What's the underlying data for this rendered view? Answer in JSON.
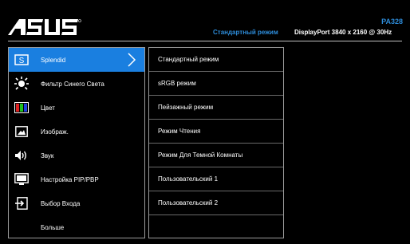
{
  "header": {
    "model": "PA328",
    "mode": "Стандартный режим",
    "signal": "DisplayPort  3840 x 2160 @ 30Hz"
  },
  "menu": [
    {
      "label": "Splendid",
      "icon": "splendid-icon"
    },
    {
      "label": "Фильтр Синего Света",
      "icon": "bluelight-icon"
    },
    {
      "label": "Цвет",
      "icon": "color-icon"
    },
    {
      "label": "Изображ.",
      "icon": "image-icon"
    },
    {
      "label": "Звук",
      "icon": "speaker-icon"
    },
    {
      "label": "Настройка PIP/PBP",
      "icon": "pip-icon"
    },
    {
      "label": "Выбор Входа",
      "icon": "input-icon"
    },
    {
      "label": "Больше",
      "icon": ""
    }
  ],
  "submenu": [
    {
      "label": "Стандартный режим"
    },
    {
      "label": "sRGB режим"
    },
    {
      "label": "Пейзажный режим"
    },
    {
      "label": "Режим Чтения"
    },
    {
      "label": "Режим Для Темной Комнаты"
    },
    {
      "label": "Пользовательский 1"
    },
    {
      "label": "Пользовательский 2"
    }
  ],
  "colors": {
    "accent": "#1a7fe0",
    "brand_text": "#2d8bd8"
  }
}
